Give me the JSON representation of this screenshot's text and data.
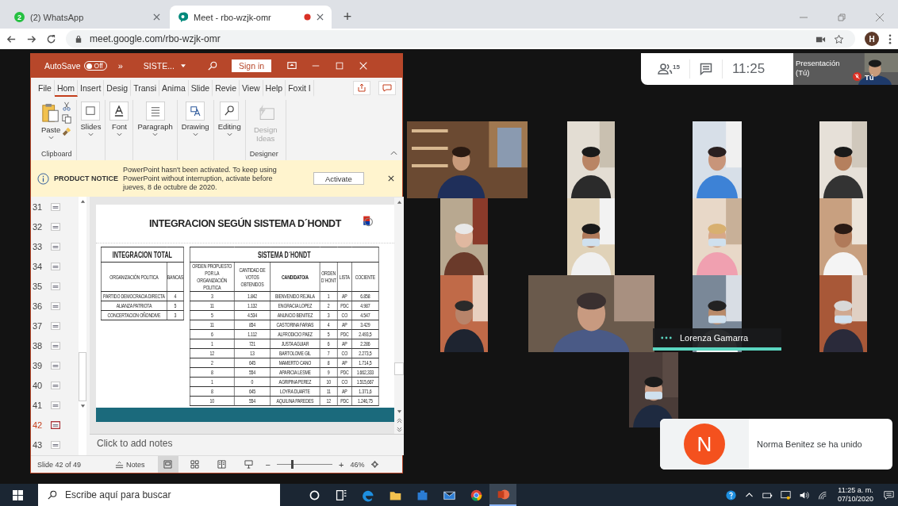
{
  "browser": {
    "tabs": [
      {
        "title": "(2) WhatsApp",
        "badge": "2",
        "selected": false,
        "recording": false
      },
      {
        "title": "Meet - rbo-wzjk-omr",
        "selected": true,
        "recording": true
      }
    ],
    "new_tab": "+",
    "url": "meet.google.com/rbo-wzjk-omr",
    "avatar": "H"
  },
  "powerpoint": {
    "autosave": "AutoSave",
    "autosave_state": "Off",
    "overflow": "»",
    "file_name": "SISTE...",
    "sign_in": "Sign in",
    "tabs": [
      {
        "label": "File",
        "selected": false
      },
      {
        "label": "Hom",
        "selected": true
      },
      {
        "label": "Insert",
        "selected": false
      },
      {
        "label": "Desig",
        "selected": false
      },
      {
        "label": "Transi",
        "selected": false
      },
      {
        "label": "Anima",
        "selected": false
      },
      {
        "label": "Slide",
        "selected": false
      },
      {
        "label": "Revie",
        "selected": false
      },
      {
        "label": "View",
        "selected": false
      },
      {
        "label": "Help",
        "selected": false
      },
      {
        "label": "Foxit I",
        "selected": false
      }
    ],
    "ribbon": {
      "buttons": [
        {
          "kind": "paste",
          "label": "Paste",
          "disabled": false
        },
        {
          "kind": "slides",
          "label": "Slides",
          "disabled": false
        },
        {
          "kind": "font",
          "label": "Font",
          "disabled": false
        },
        {
          "kind": "paragraph",
          "label": "Paragraph",
          "disabled": false
        },
        {
          "kind": "drawing",
          "label": "Drawing",
          "disabled": false
        },
        {
          "kind": "editing",
          "label": "Editing",
          "disabled": false
        },
        {
          "kind": "design",
          "label": "Design Ideas",
          "disabled": true
        }
      ],
      "groups": [
        "Clipboard",
        "Designer"
      ]
    },
    "notice": {
      "title": "PRODUCT NOTICE",
      "message": "PowerPoint hasn't been activated. To keep using PowerPoint without interruption, activate before jueves, 8 de octubre de 2020.",
      "button": "Activate"
    },
    "thumbnails": [
      {
        "number": "31",
        "selected": false
      },
      {
        "number": "32",
        "selected": false
      },
      {
        "number": "33",
        "selected": false
      },
      {
        "number": "34",
        "selected": false
      },
      {
        "number": "35",
        "selected": false
      },
      {
        "number": "36",
        "selected": false
      },
      {
        "number": "37",
        "selected": false
      },
      {
        "number": "38",
        "selected": false
      },
      {
        "number": "39",
        "selected": false
      },
      {
        "number": "40",
        "selected": false
      },
      {
        "number": "41",
        "selected": false
      },
      {
        "number": "42",
        "selected": true
      },
      {
        "number": "43",
        "selected": false
      }
    ],
    "slide": {
      "title": "INTEGRACION SEGÚN SISTEMA D´HONDT",
      "left_table": {
        "title": "INTEGRACION TOTAL",
        "columns": [
          "ORGANIZACIÓN POLITICA",
          "BANCAS"
        ],
        "rows": [
          [
            "PARTIDO DEMOCRACIA DIRECTA",
            "4"
          ],
          [
            "ALIANZA PATRIOTA",
            "5"
          ],
          [
            "CONCERTACION OÑONDIVE",
            "3"
          ]
        ]
      },
      "right_table": {
        "title": "SISTEMA D´HONDT",
        "columns": [
          "ORDEN PROPUESTO POR LA ORGANIZACIÓN POLITICA",
          "CANTIDAD DE VOTOS OBTENIDOS",
          "CANDIDATO/A",
          "ORDEN D´HONT",
          "LISTA",
          "COCIENTE"
        ],
        "rows": [
          [
            "3",
            "1.842",
            "BIENVENIDO REJALA",
            "1",
            "AP",
            "6.858"
          ],
          [
            "11",
            "1.132",
            "ENGRACIA LOPEZ",
            "2",
            "PDC",
            "4.987"
          ],
          [
            "5",
            "4.534",
            "ANUNCIO BENITEZ",
            "3",
            "CO",
            "4.547"
          ],
          [
            "11",
            "854",
            "CASTORINA FARIAS",
            "4",
            "AP",
            "3.429"
          ],
          [
            "6",
            "1.112",
            "ALFRODICIO PAEZ",
            "5",
            "PDC",
            "2.493,5"
          ],
          [
            "1",
            "721",
            "JUSTA AGUIAR",
            "6",
            "AP",
            "2.286"
          ],
          [
            "12",
            "13",
            "BARTOLOME GIL",
            "7",
            "CO",
            "2.273,5"
          ],
          [
            "2",
            "645",
            "MAMERTO CANO",
            "8",
            "AP",
            "1.714,5"
          ],
          [
            "8",
            "554",
            "APARICIA LESME",
            "9",
            "PDC",
            "1.662,333"
          ],
          [
            "1",
            "0",
            "AGRIPINA PEREZ",
            "10",
            "CO",
            "1.515,667"
          ],
          [
            "8",
            "645",
            "LOYRA DUARTE",
            "11",
            "AP",
            "1.371,6"
          ],
          [
            "10",
            "554",
            "AQUILINA PAREDES",
            "12",
            "PDC",
            "1.246,75"
          ]
        ]
      }
    },
    "notes": {
      "placeholder": "Click to add notes"
    },
    "status": {
      "slide_info": "Slide 42 of 49",
      "notes": "Notes",
      "views": [
        {
          "kind": "normal",
          "selected": true
        },
        {
          "kind": "sorter",
          "selected": false
        },
        {
          "kind": "reading",
          "selected": false
        },
        {
          "kind": "slideshow",
          "selected": false
        }
      ],
      "zoom": {
        "minus": "−",
        "plus": "+",
        "level": 0.27,
        "reading": "46%"
      }
    }
  },
  "meet": {
    "participants_count": "15",
    "time": "11:25",
    "self": {
      "label": "Presentación (Tú)",
      "name": "Tú",
      "muted": true
    },
    "speaker": {
      "name": "Lorenza Gamarra",
      "speaking": true
    },
    "notification": {
      "initial": "N",
      "text": "Norma Benitez se ha unido"
    }
  },
  "taskbar": {
    "search": {
      "placeholder": "Escribe aquí para buscar"
    },
    "apps": [
      {
        "kind": "cortana",
        "active": false
      },
      {
        "kind": "taskview",
        "active": false
      },
      {
        "kind": "edge",
        "active": false
      },
      {
        "kind": "explorer",
        "active": false
      },
      {
        "kind": "store",
        "active": false
      },
      {
        "kind": "mail",
        "active": false
      },
      {
        "kind": "chrome",
        "active": false
      },
      {
        "kind": "powerpoint",
        "active": true
      }
    ],
    "time": "11:25 a. m.",
    "date": "07/10/2020"
  }
}
